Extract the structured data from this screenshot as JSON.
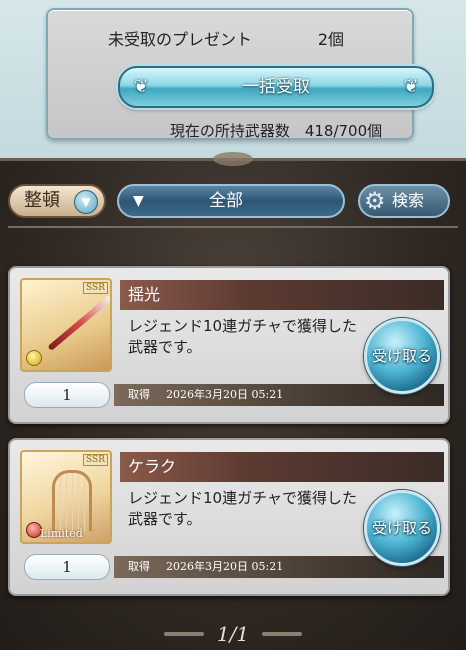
{
  "header": {
    "unclaimed_label": "未受取のプレゼント",
    "unclaimed_count": "2個",
    "claim_all_button": "一括受取",
    "weapon_stock": "現在の所持武器数　418/700個"
  },
  "toolbar": {
    "sort_label": "整頓",
    "filter_label": "全部",
    "search_label": "検索"
  },
  "items": [
    {
      "name": "揺光",
      "rarity": "SSR",
      "description": "レジェンド10連ガチャで獲得した武器です。",
      "quantity": "1",
      "acquired_label": "取得",
      "acquired_date": "2026年3月20日 05:21",
      "receive_button": "受け取る"
    },
    {
      "name": "ケラク",
      "rarity": "SSR",
      "badge": "Limited",
      "description": "レジェンド10連ガチャで獲得した武器です。",
      "quantity": "1",
      "acquired_label": "取得",
      "acquired_date": "2026年3月20日 05:21",
      "receive_button": "受け取る"
    }
  ],
  "pagination": {
    "page": "1/1"
  }
}
